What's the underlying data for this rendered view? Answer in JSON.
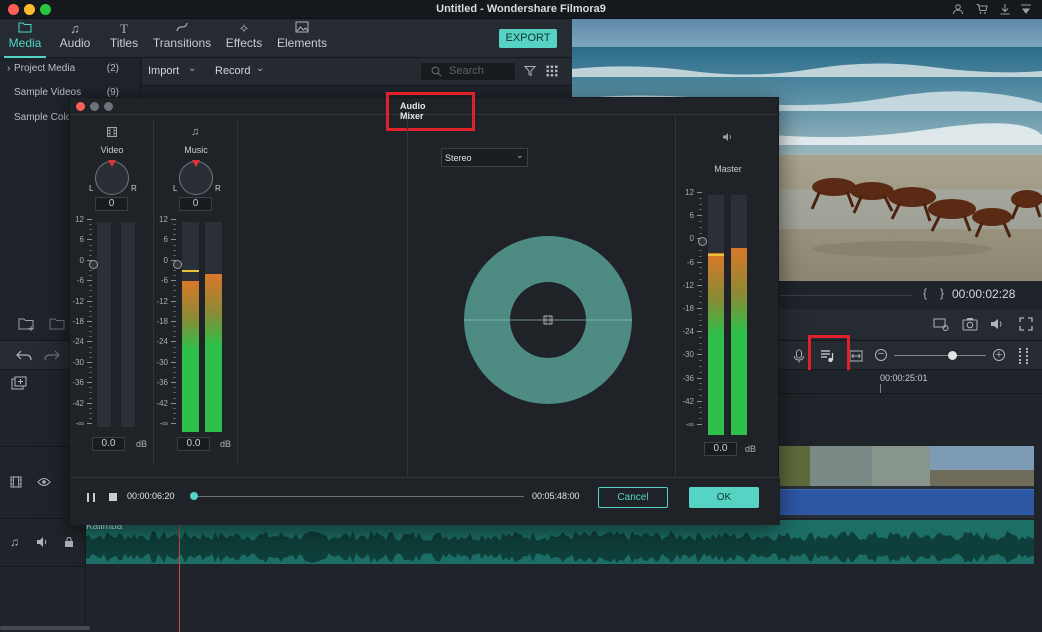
{
  "window": {
    "title": "Untitled - Wondershare Filmora9",
    "title_icons": [
      "user-icon",
      "cart-icon",
      "download-icon"
    ]
  },
  "tabs": [
    {
      "label": "Media",
      "icon": "folder-icon",
      "active": true
    },
    {
      "label": "Audio",
      "icon": "music-note-icon",
      "active": false
    },
    {
      "label": "Titles",
      "icon": "text-icon",
      "active": false
    },
    {
      "label": "Transitions",
      "icon": "transition-icon",
      "active": false
    },
    {
      "label": "Effects",
      "icon": "effects-icon",
      "active": false
    },
    {
      "label": "Elements",
      "icon": "image-icon",
      "active": false
    }
  ],
  "export_label": "EXPORT",
  "sidebar": {
    "items": [
      {
        "label": "Project Media",
        "count": "(2)",
        "glyph": "›"
      },
      {
        "label": "Sample Videos",
        "count": "(9)"
      },
      {
        "label": "Sample Colo",
        "count": ""
      }
    ]
  },
  "media_toolbar": {
    "import_label": "Import",
    "record_label": "Record",
    "search_placeholder": "Search"
  },
  "preview": {
    "timecode": "00:00:02:28",
    "bracket_left": "{",
    "bracket_right": "}"
  },
  "timeline": {
    "ruler_time": "00:00:25:01",
    "audio_clip_label": "Kalimba",
    "zoom_minus": "−",
    "zoom_plus": "+"
  },
  "audio_mixer": {
    "title": "Audio Mixer",
    "channels": [
      {
        "name": "Video",
        "pan_value": "0",
        "db_value": "0.0",
        "db_unit": "dB",
        "left_label": "L",
        "right_label": "R",
        "level_left": 0.0,
        "level_right": 0.0
      },
      {
        "name": "Music",
        "pan_value": "0",
        "db_value": "0.0",
        "db_unit": "dB",
        "left_label": "L",
        "right_label": "R",
        "level_left": 0.72,
        "level_right": 0.75
      }
    ],
    "scale_labels": [
      "12",
      "6",
      "0",
      "-6",
      "-12",
      "-18",
      "-24",
      "-30",
      "-36",
      "-42",
      "-∞"
    ],
    "master_scale_labels": [
      "12",
      "6",
      "0",
      "-6",
      "-12",
      "-18",
      "-24",
      "-30",
      "-36",
      "-42",
      "-∞"
    ],
    "output_mode": "Stereo",
    "master": {
      "name": "Master",
      "db_value": "0.0",
      "db_unit": "dB",
      "level_left": 0.76,
      "level_right": 0.78
    },
    "playback": {
      "current_time": "00:00:06:20",
      "total_time": "00:05:48:00",
      "progress": 0.0
    },
    "cancel_label": "Cancel",
    "ok_label": "OK"
  },
  "colors": {
    "accent": "#56d3c3",
    "highlight": "#e0202a",
    "meter_green": "#2ec04a",
    "meter_orange": "#d9782a",
    "panner": "#4e8c83"
  }
}
